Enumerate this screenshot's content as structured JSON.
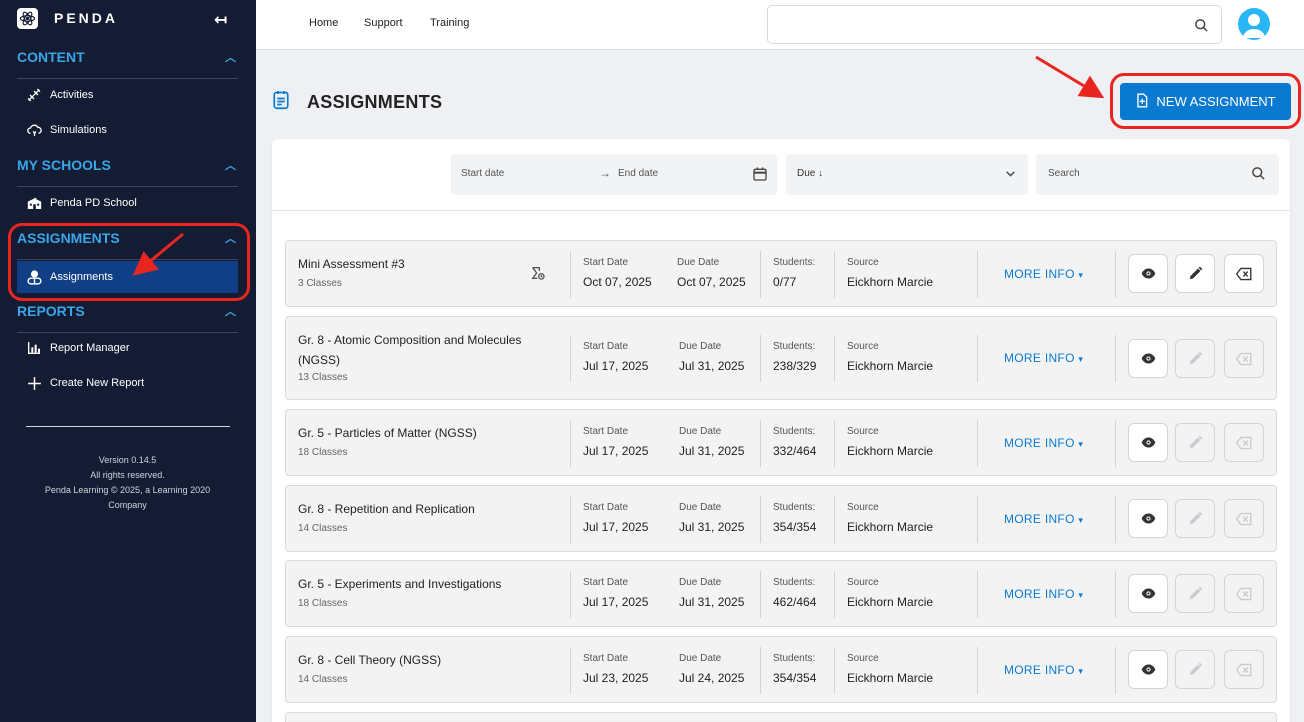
{
  "brand": {
    "name": "PENDA"
  },
  "sidebar": {
    "sections": [
      {
        "title": "CONTENT",
        "items": [
          {
            "label": "Activities"
          },
          {
            "label": "Simulations"
          }
        ]
      },
      {
        "title": "MY SCHOOLS",
        "items": [
          {
            "label": "Penda PD School"
          }
        ]
      },
      {
        "title": "ASSIGNMENTS",
        "items": [
          {
            "label": "Assignments"
          }
        ]
      },
      {
        "title": "REPORTS",
        "items": [
          {
            "label": "Report Manager"
          },
          {
            "label": "Create New Report"
          }
        ]
      }
    ],
    "footer": {
      "version": "Version 0.14.5",
      "rights": "All rights reserved.",
      "company": "Penda Learning © 2025, a Learning 2020 Company"
    }
  },
  "topnav": {
    "items": [
      "Home",
      "Support",
      "Training"
    ]
  },
  "page": {
    "title": "ASSIGNMENTS",
    "new_button": "NEW ASSIGNMENT"
  },
  "filters": {
    "start_date": "Start date",
    "end_date": "End date",
    "arrow": "→",
    "sort": "Due ↓",
    "search": "Search"
  },
  "labels": {
    "start_date": "Start Date",
    "due_date": "Due Date",
    "students": "Students:",
    "source": "Source",
    "more_info": "MORE INFO"
  },
  "assignments": [
    {
      "title": "Mini Assessment #3",
      "classes": "3 Classes",
      "start": "Oct 07, 2025",
      "due": "Oct 07, 2025",
      "students": "0/77",
      "source": "Eickhorn Marcie"
    },
    {
      "title": "Gr. 8 - Atomic Composition and Molecules (NGSS)",
      "classes": "13 Classes",
      "start": "Jul 17, 2025",
      "due": "Jul 31, 2025",
      "students": "238/329",
      "source": "Eickhorn Marcie"
    },
    {
      "title": "Gr. 5 - Particles of Matter (NGSS)",
      "classes": "18 Classes",
      "start": "Jul 17, 2025",
      "due": "Jul 31, 2025",
      "students": "332/464",
      "source": "Eickhorn Marcie"
    },
    {
      "title": "Gr. 8 - Repetition and Replication",
      "classes": "14 Classes",
      "start": "Jul 17, 2025",
      "due": "Jul 31, 2025",
      "students": "354/354",
      "source": "Eickhorn Marcie"
    },
    {
      "title": "Gr. 5 - Experiments and Investigations",
      "classes": "18 Classes",
      "start": "Jul 17, 2025",
      "due": "Jul 31, 2025",
      "students": "462/464",
      "source": "Eickhorn Marcie"
    },
    {
      "title": "Gr. 8 - Cell Theory (NGSS)",
      "classes": "14 Classes",
      "start": "Jul 23, 2025",
      "due": "Jul 24, 2025",
      "students": "354/354",
      "source": "Eickhorn Marcie"
    }
  ],
  "colors": {
    "sidebar_bg": "#131c33",
    "accent": "#0a7ad1",
    "section_title": "#3aa6e8",
    "highlight": "#e8251f"
  }
}
